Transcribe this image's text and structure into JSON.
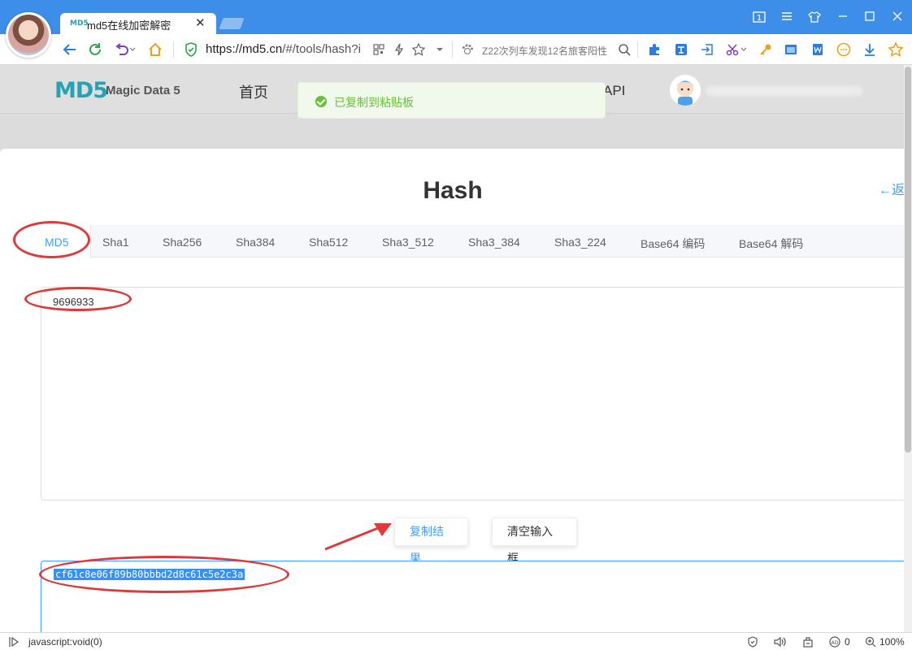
{
  "browser": {
    "tab_title": "md5在线加密解密",
    "tab_favicon": "MD5",
    "url_scheme_host": "https://md5.cn",
    "url_path": "/#/tools/hash?i",
    "search_placeholder": "Z22次列车发现12名旅客阳性",
    "window_badge": "1"
  },
  "site": {
    "logo": "MD5",
    "logo_text": "Magic Data 5",
    "nav_home": "首页",
    "nav_api": "API"
  },
  "toast": {
    "message": "已复制到粘贴板",
    "color": "#67c23a"
  },
  "tool": {
    "title": "Hash",
    "back_label": "←返",
    "tabs": [
      {
        "label": "MD5",
        "active": true
      },
      {
        "label": "Sha1"
      },
      {
        "label": "Sha256"
      },
      {
        "label": "Sha384"
      },
      {
        "label": "Sha512"
      },
      {
        "label": "Sha3_512"
      },
      {
        "label": "Sha3_384"
      },
      {
        "label": "Sha3_224"
      },
      {
        "label": "Base64 编码"
      },
      {
        "label": "Base64 解码"
      }
    ],
    "input_value": "9696933",
    "copy_button": "复制结果",
    "clear_button": "清空输入框",
    "output_value": "cf61c8e06f89b80bbbd2d8c61c5e2c3a"
  },
  "statusbar": {
    "link_text": "javascript:void(0)",
    "blocked_count": "0",
    "zoom": "100%"
  },
  "colors": {
    "accent": "#409eff",
    "annotation": "#e0393b",
    "titlebar": "#3c8ee8"
  }
}
